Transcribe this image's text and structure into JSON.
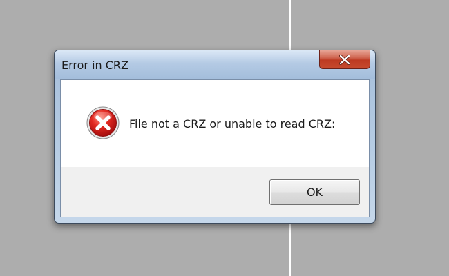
{
  "window": {
    "title": "Error in CRZ",
    "close_icon": "close-x-icon"
  },
  "message": {
    "icon": "error-icon",
    "text": "File not a CRZ or unable to read CRZ:"
  },
  "buttons": {
    "ok_label": "OK"
  },
  "colors": {
    "desktop_background": "#adadad",
    "close_button": "#c64a2e",
    "error_icon": "#d41f1f"
  }
}
